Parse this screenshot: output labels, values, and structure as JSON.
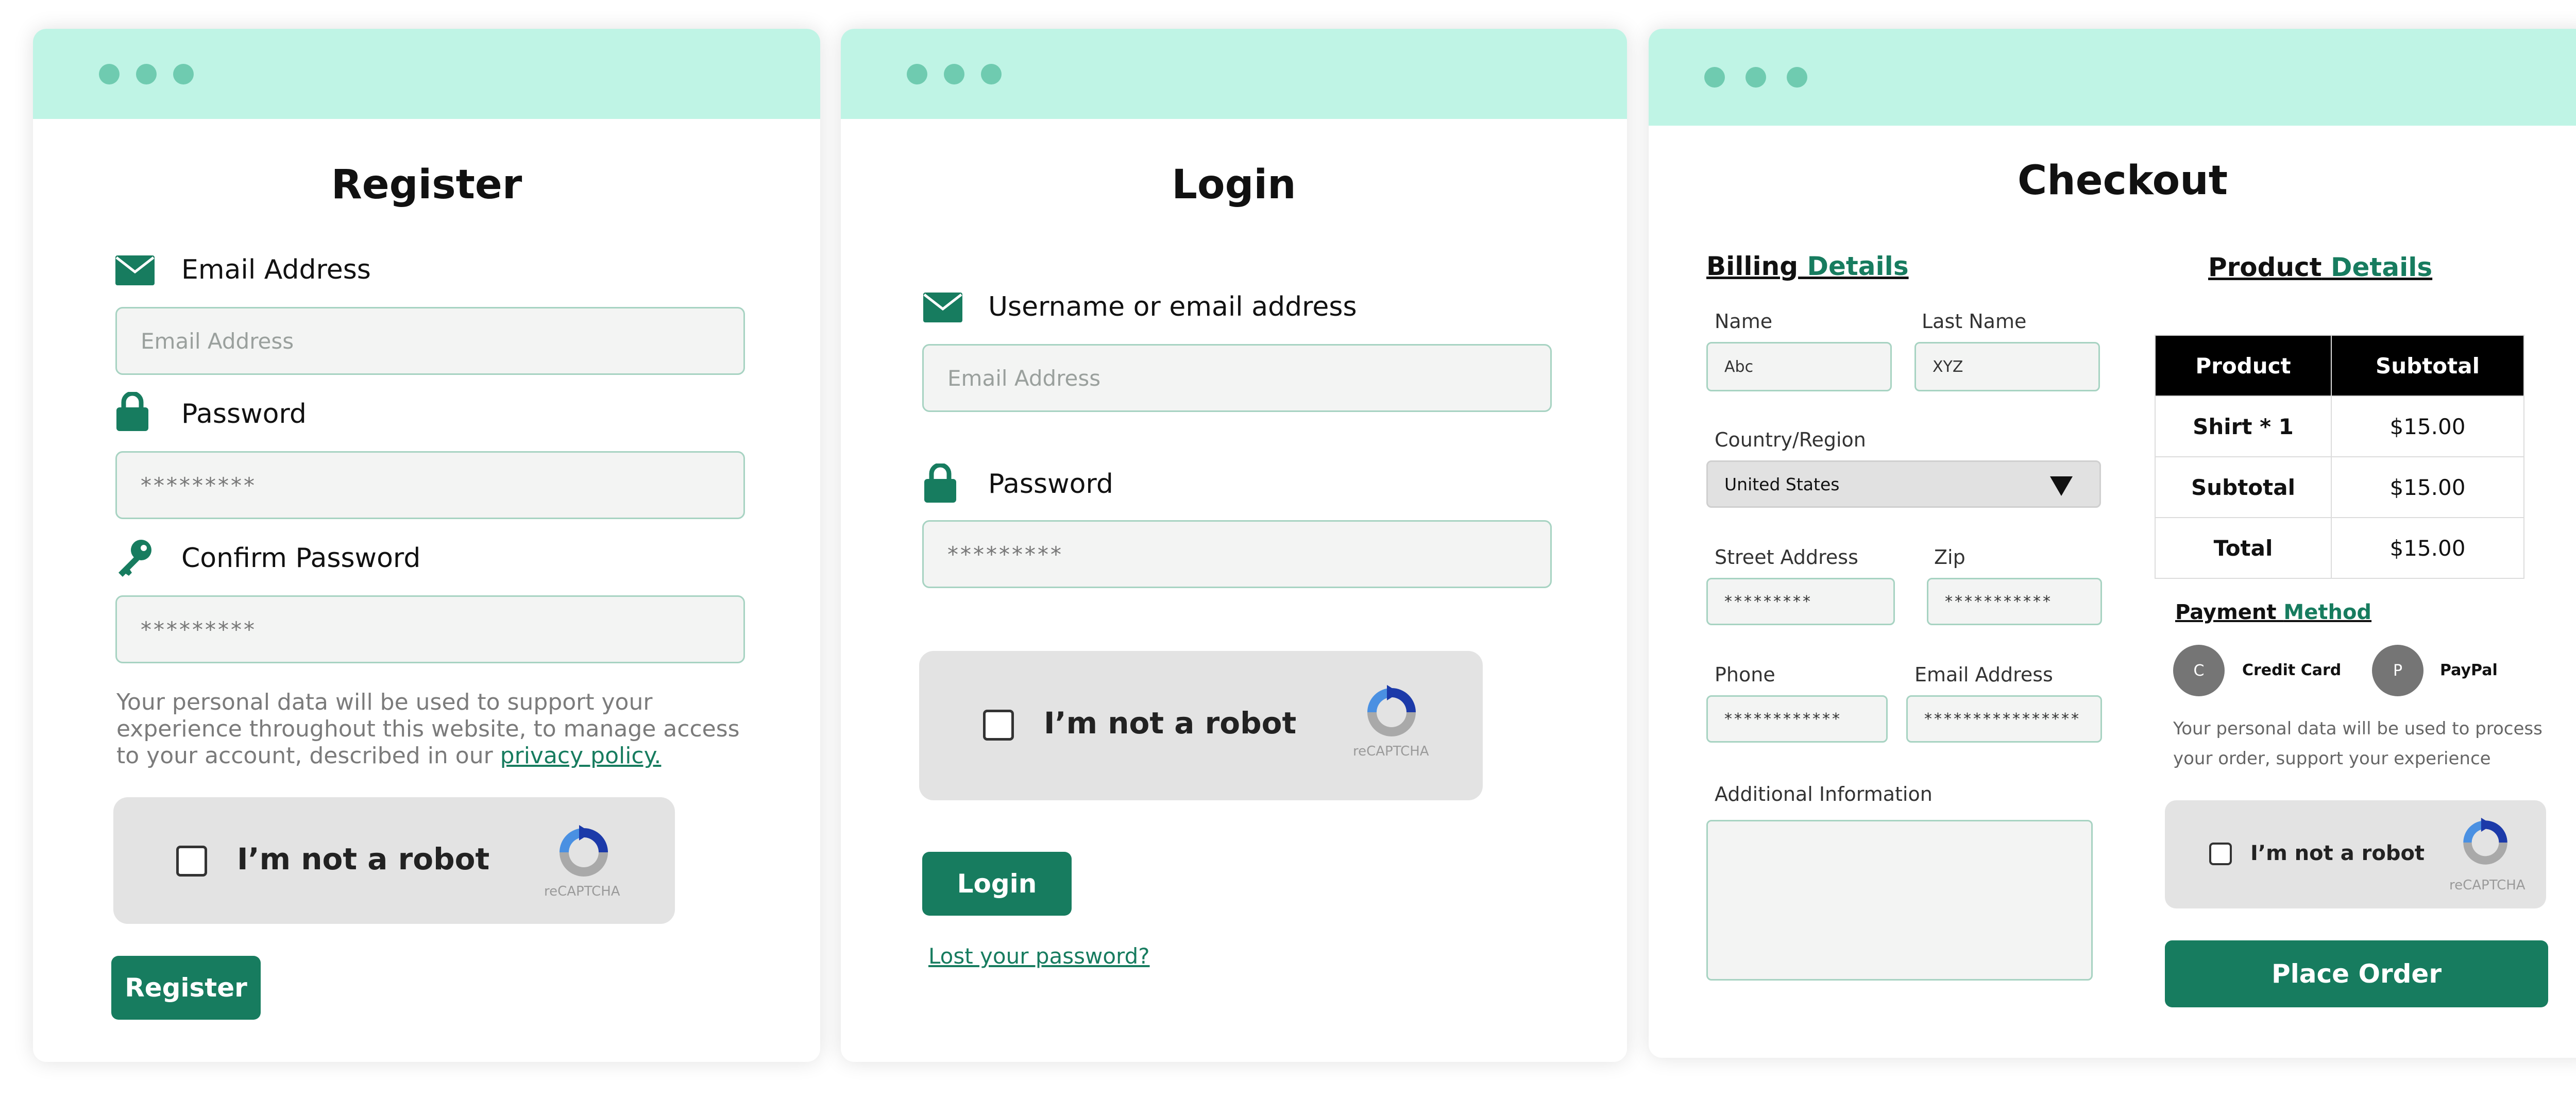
{
  "register": {
    "title": "Register",
    "email_label": "Email Address",
    "email_placeholder": "Email Address",
    "password_label": "Password",
    "password_value": "*********",
    "confirm_label": "Confirm Password",
    "confirm_value": "*********",
    "privacy_text": "Your personal data will be used to support your experience throughout this website, to manage access to your account, described in our ",
    "privacy_link": "privacy policy.",
    "captcha_text": "I’m not a robot",
    "captcha_brand": "reCAPTCHA",
    "button": "Register"
  },
  "login": {
    "title": "Login",
    "username_label": "Username or email address",
    "username_placeholder": "Email Address",
    "password_label": "Password",
    "password_value": "*********",
    "captcha_text": "I’m not a robot",
    "captcha_brand": "reCAPTCHA",
    "button": "Login",
    "lost_password": "Lost your password?"
  },
  "checkout": {
    "title": "Checkout",
    "billing_head_a": "Billing",
    "billing_head_b": "Details",
    "name_label": "Name",
    "name_value": "Abc",
    "last_label": "Last Name",
    "last_value": "XYZ",
    "country_label": "Country/Region",
    "country_value": "United States",
    "street_label": "Street Address",
    "street_value": "*********",
    "zip_label": "Zip",
    "zip_value": "***********",
    "phone_label": "Phone",
    "phone_value": "************",
    "email_label": "Email Address",
    "email_value": "****************",
    "additional_label": "Additional Information",
    "product_head_a": "Product",
    "product_head_b": "Details",
    "table": {
      "headers": [
        "Product",
        "Subtotal"
      ],
      "rows": [
        [
          "Shirt * 1",
          "$15.00"
        ],
        [
          "Subtotal",
          "$15.00"
        ],
        [
          "Total",
          "$15.00"
        ]
      ]
    },
    "payment_head_a": "Payment",
    "payment_head_b": "Method",
    "payment_options": [
      {
        "initial": "C",
        "label": "Credit Card"
      },
      {
        "initial": "P",
        "label": "PayPal"
      }
    ],
    "payment_note": "Your personal data will be used to process your order, support your experience",
    "captcha_text": "I’m not a robot",
    "captcha_brand": "reCAPTCHA",
    "button": "Place Order"
  },
  "colors": {
    "accent": "#177c5f",
    "header_bar": "#bff4e5",
    "dots": "#6fcbb0"
  }
}
